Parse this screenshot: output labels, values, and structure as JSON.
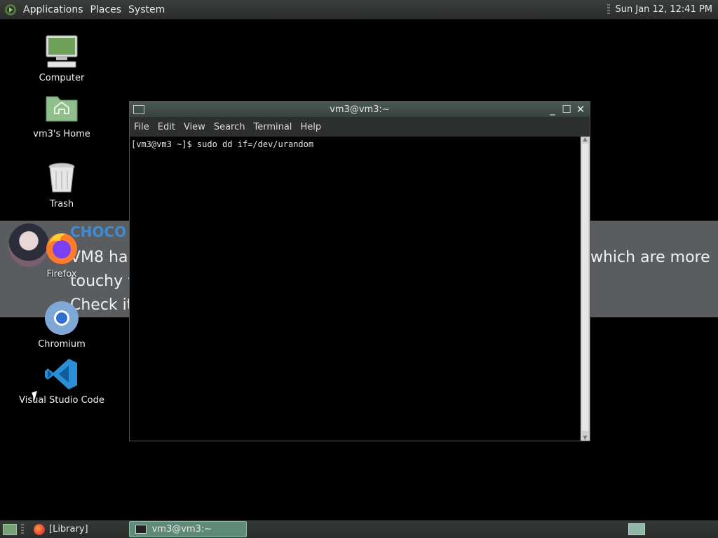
{
  "top_panel": {
    "menus": [
      "Applications",
      "Places",
      "System"
    ],
    "clock": "Sun Jan 12, 12:41 PM"
  },
  "desktop": {
    "icons": [
      {
        "label": "Computer",
        "icon": "computer-icon"
      },
      {
        "label": "vm3's Home",
        "icon": "home-folder-icon"
      },
      {
        "label": "Trash",
        "icon": "trash-icon"
      },
      {
        "label": "Firefox",
        "icon": "firefox-icon"
      },
      {
        "label": "Chromium",
        "icon": "chromium-icon"
      },
      {
        "label": "Visual Studio Code",
        "icon": "vscode-icon"
      }
    ]
  },
  "notification": {
    "title": "CHOCO",
    "line1": "VM8 ha",
    "line1_tail": "which are more",
    "line2": "touchy w",
    "line3": "Check it"
  },
  "terminal": {
    "title": "vm3@vm3:~",
    "menu": [
      "File",
      "Edit",
      "View",
      "Search",
      "Terminal",
      "Help"
    ],
    "prompt": "[vm3@vm3 ~]$ sudo dd if=/dev/urandom"
  },
  "bottom_panel": {
    "tasks": [
      {
        "label": "[Library]",
        "icon": "firefox-icon",
        "active": false
      },
      {
        "label": "vm3@vm3:~",
        "icon": "terminal-icon",
        "active": true
      }
    ]
  },
  "colors": {
    "desktop_bg": "#000000",
    "panel_bg": "#2e312f",
    "active_task": "#5e8a78",
    "notif_title": "#3f8bd6"
  }
}
